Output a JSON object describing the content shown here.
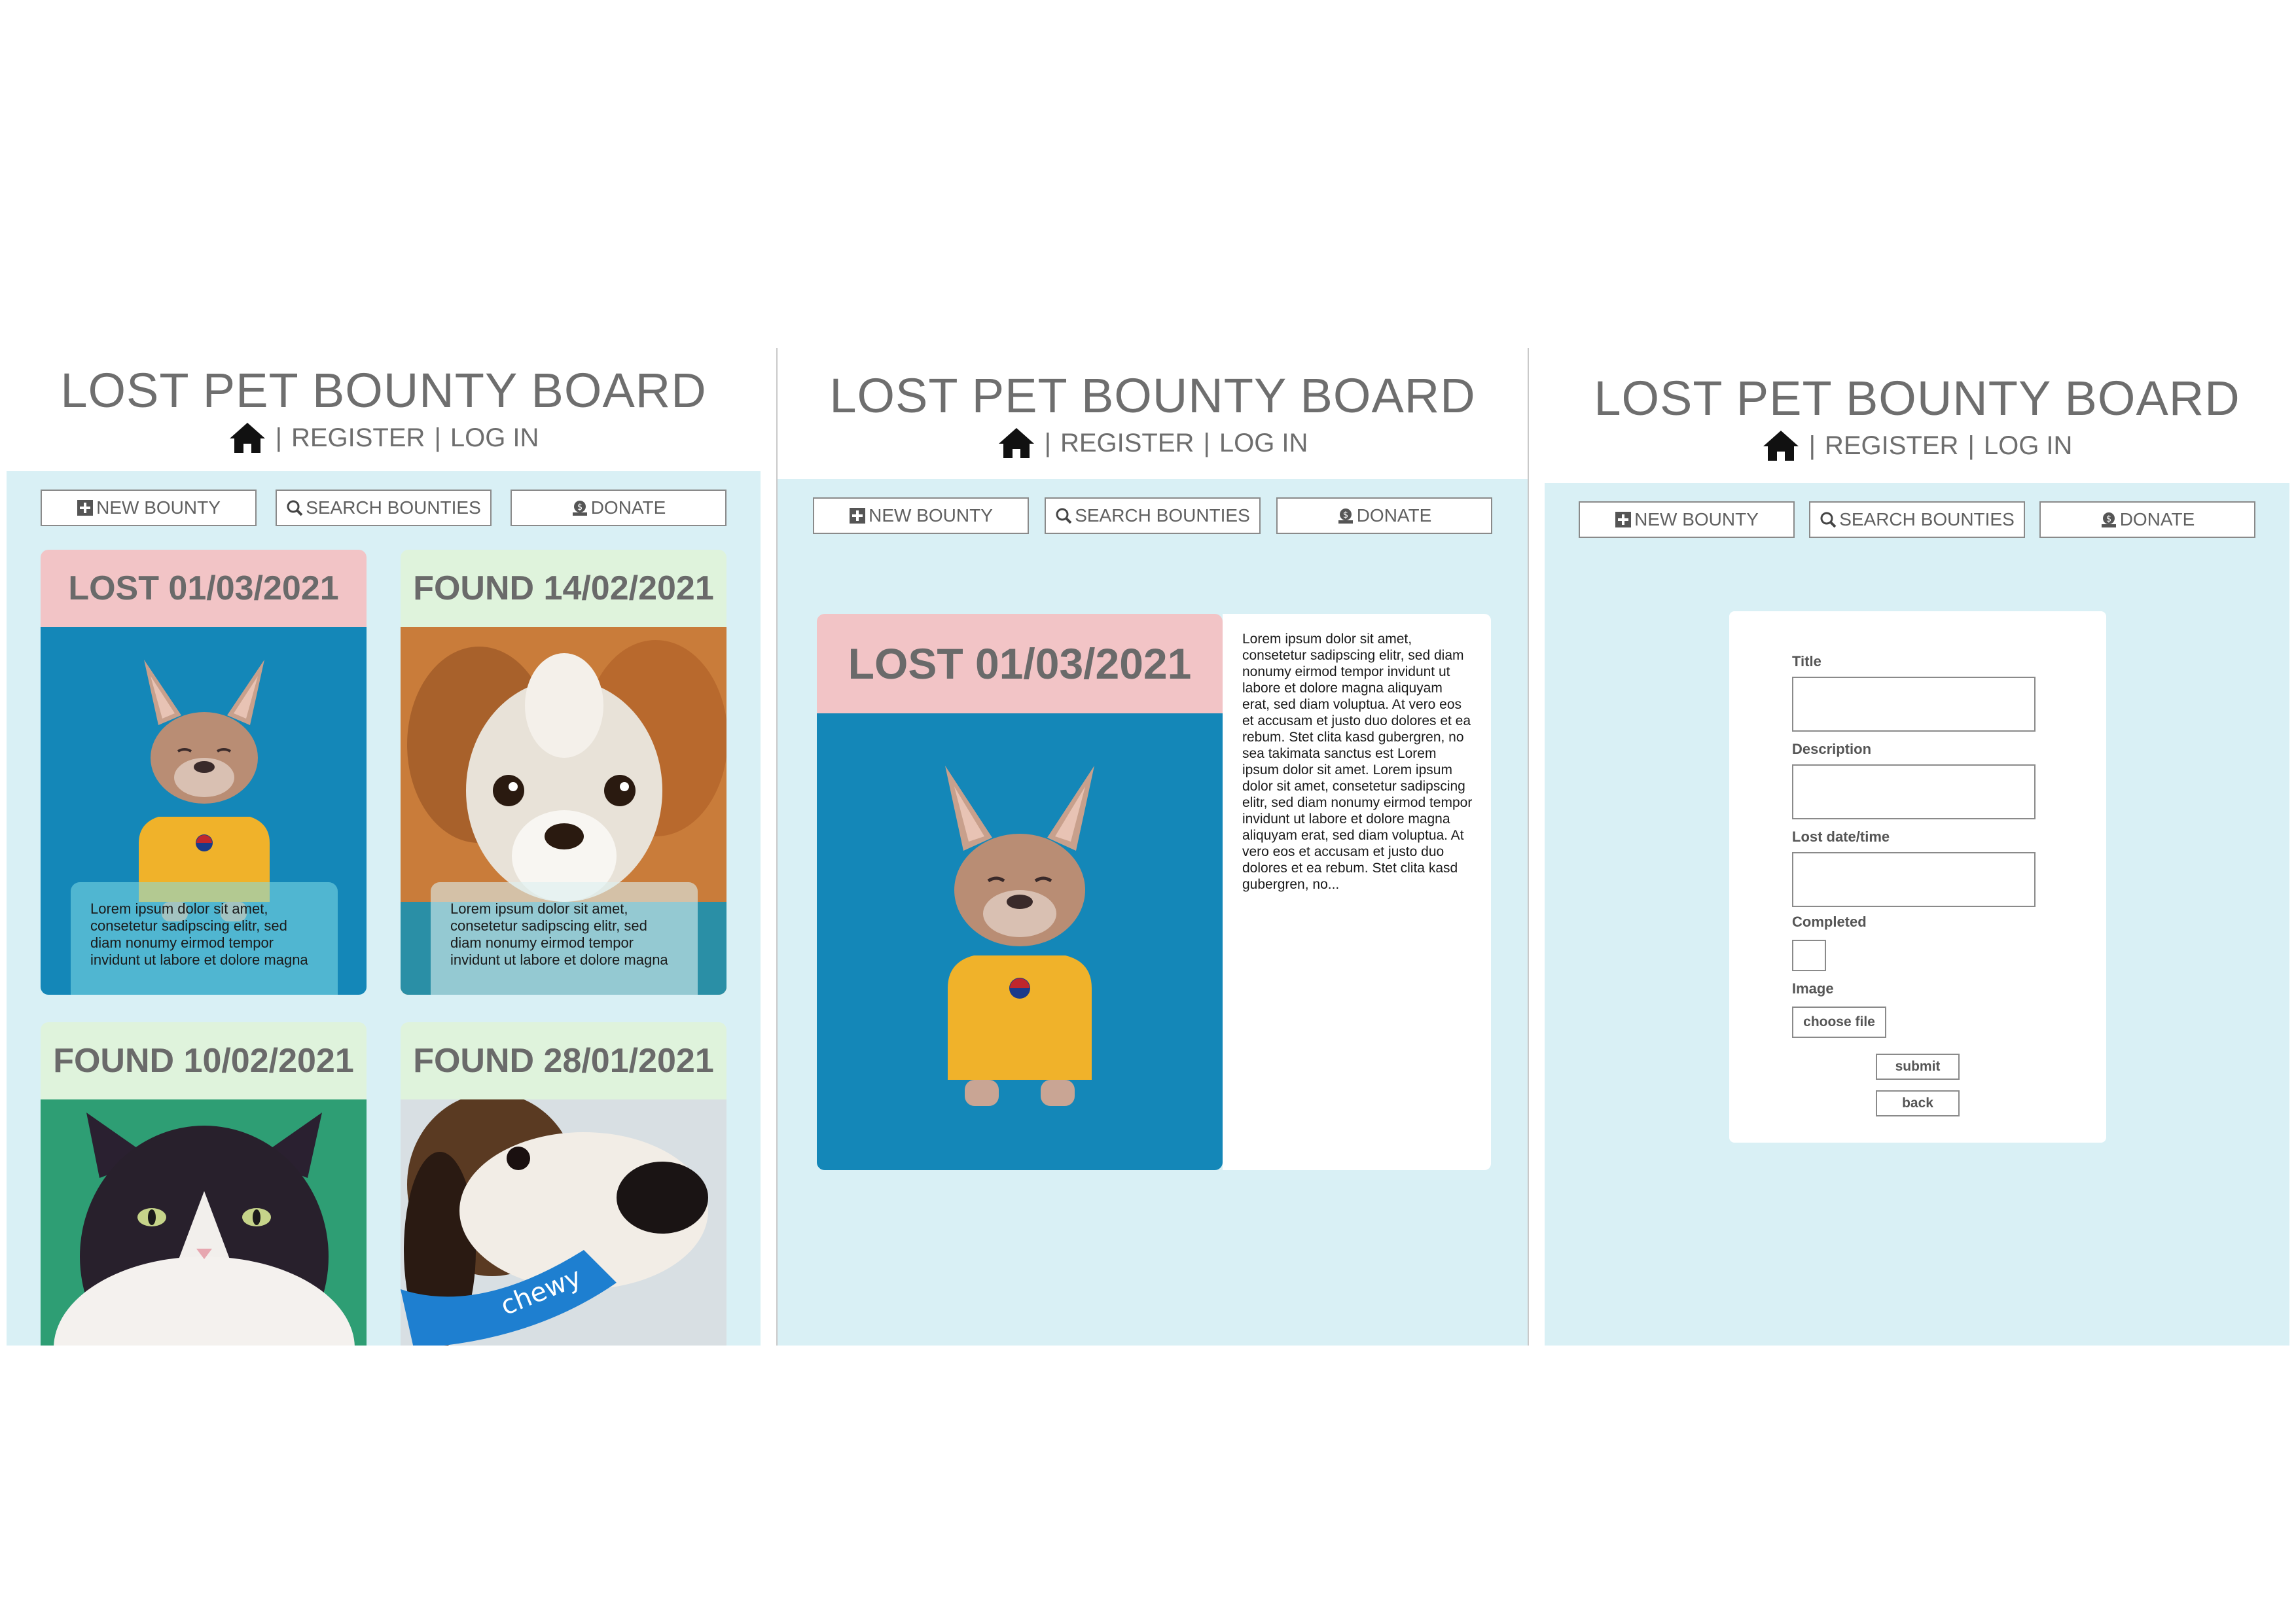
{
  "app": {
    "title": "LOST PET BOUNTY BOARD",
    "nav": {
      "register": "REGISTER",
      "login": "LOG IN",
      "separator": "|"
    },
    "toolbar": {
      "new_bounty": "NEW BOUNTY",
      "search": "SEARCH BOUNTIES",
      "donate": "DONATE"
    }
  },
  "colors": {
    "background": "#d9f0f5",
    "lost_header": "#f2c4c6",
    "found_header": "#dff3dc",
    "text_gray": "#6e6e6e"
  },
  "listing": {
    "cards": [
      {
        "status": "LOST 01/03/2021",
        "type": "lost",
        "image": "french-bulldog-yellow-sweater",
        "excerpt": "Lorem ipsum dolor sit amet, consetetur sadipscing elitr, sed diam nonumy eirmod tempor invidunt ut labore et dolore magna"
      },
      {
        "status": "FOUND 14/02/2021",
        "type": "found",
        "image": "scruffy-terrier-face",
        "excerpt": "Lorem ipsum dolor sit amet, consetetur sadipscing elitr, sed diam nonumy eirmod tempor invidunt ut labore et dolore magna"
      },
      {
        "status": "FOUND 10/02/2021",
        "type": "found",
        "image": "black-white-cat"
      },
      {
        "status": "FOUND 28/01/2021",
        "type": "found",
        "image": "beagle-with-chewy-toy",
        "toy_text": "chewy"
      }
    ]
  },
  "detail": {
    "status": "LOST 01/03/2021",
    "image": "french-bulldog-yellow-sweater",
    "description": "Lorem ipsum dolor sit amet, consetetur sadipscing elitr, sed diam nonumy eirmod tempor invidunt ut labore et dolore magna aliquyam erat, sed diam voluptua. At vero eos et accusam et justo duo dolores et ea rebum. Stet clita kasd gubergren, no sea takimata sanctus est Lorem ipsum dolor sit amet. Lorem ipsum dolor sit amet, consetetur sadipscing elitr, sed diam nonumy eirmod tempor invidunt ut labore et dolore magna aliquyam erat, sed diam voluptua. At vero eos et accusam et justo duo dolores et ea rebum. Stet clita kasd gubergren, no..."
  },
  "form": {
    "title_label": "Title",
    "description_label": "Description",
    "lost_date_label": "Lost date/time",
    "completed_label": "Completed",
    "image_label": "Image",
    "choose_file": "choose file",
    "submit": "submit",
    "back": "back"
  },
  "icons": [
    "home-icon",
    "plus-square-icon",
    "search-icon",
    "donate-icon"
  ]
}
